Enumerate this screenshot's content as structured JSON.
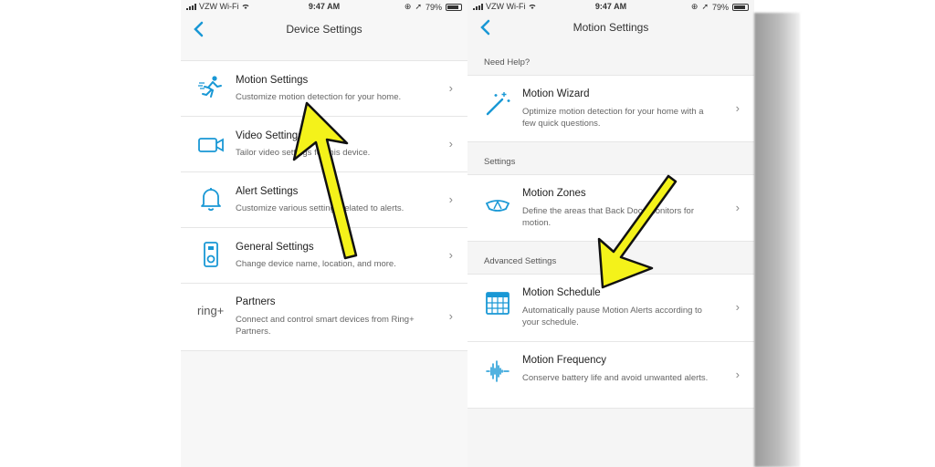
{
  "colors": {
    "accent": "#1998d5",
    "arrow_fill": "#f4f21a",
    "arrow_stroke": "#111111"
  },
  "left": {
    "status": {
      "carrier": "VZW Wi-Fi",
      "time": "9:47 AM",
      "battery": "79%"
    },
    "nav": {
      "title": "Device Settings",
      "back_icon": "chevron-left-icon"
    },
    "items": [
      {
        "icon": "running-person-icon",
        "title": "Motion Settings",
        "subtitle": "Customize motion detection for your home."
      },
      {
        "icon": "video-camera-icon",
        "title": "Video Settings",
        "subtitle": "Tailor video settings for this device."
      },
      {
        "icon": "bell-icon",
        "title": "Alert Settings",
        "subtitle": "Customize various settings related to alerts."
      },
      {
        "icon": "doorbell-device-icon",
        "title": "General Settings",
        "subtitle": "Change device name, location, and more."
      },
      {
        "icon": "ring-plus-logo",
        "logo_text": "ring+",
        "title": "Partners",
        "subtitle": "Connect and control smart devices from Ring+ Partners."
      }
    ]
  },
  "right": {
    "status": {
      "carrier": "VZW Wi-Fi",
      "time": "9:47 AM",
      "battery": "79%"
    },
    "nav": {
      "title": "Motion Settings",
      "back_icon": "chevron-left-icon"
    },
    "sections": [
      {
        "header": "Need Help?",
        "items": [
          {
            "icon": "magic-wand-icon",
            "title": "Motion Wizard",
            "subtitle": "Optimize motion detection for your home with a few quick questions."
          }
        ]
      },
      {
        "header": "Settings",
        "items": [
          {
            "icon": "motion-zone-icon",
            "title": "Motion Zones",
            "subtitle": "Define the areas that Back Door monitors for motion."
          }
        ]
      },
      {
        "header": "Advanced Settings",
        "items": [
          {
            "icon": "calendar-grid-icon",
            "title": "Motion Schedule",
            "subtitle": "Automatically pause Motion Alerts according to your schedule."
          },
          {
            "icon": "sound-wave-icon",
            "title": "Motion Frequency",
            "subtitle": "Conserve battery life and avoid unwanted alerts."
          }
        ]
      }
    ]
  }
}
